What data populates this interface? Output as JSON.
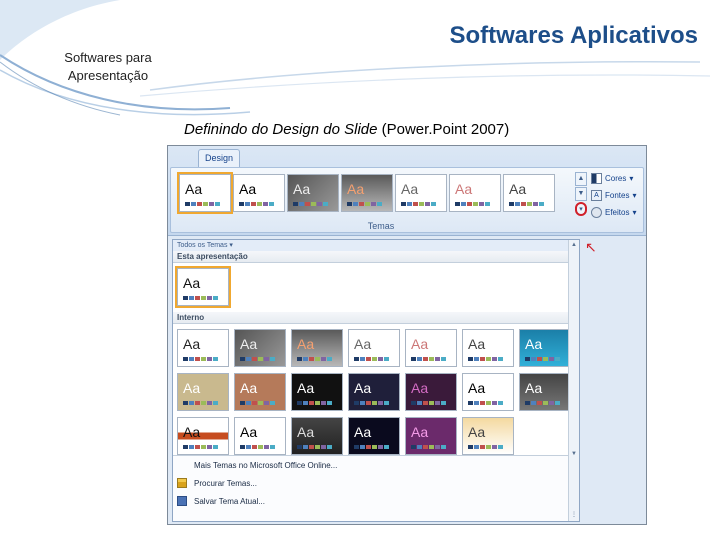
{
  "slide": {
    "title": "Softwares Aplicativos",
    "subtitle": "Softwares para Apresentação",
    "caption_italic": "Definindo do Design do Slide",
    "caption_rest": " (Power.Point 2007)"
  },
  "ribbon": {
    "tab_label": "Design",
    "group_label": "Temas",
    "cmds": [
      {
        "label": "Cores",
        "icon": "colors-icon"
      },
      {
        "label": "Fontes",
        "icon": "fonts-icon"
      },
      {
        "label": "Efeitos",
        "icon": "effects-icon"
      }
    ],
    "annotation_color": "#d0202a"
  },
  "gallery": {
    "header": "Todos os Temas",
    "section_current": "Esta apresentação",
    "section_builtin": "Interno",
    "menu": [
      {
        "label": "Mais Temas no Microsoft Office Online..."
      },
      {
        "label": "Procurar Temas..."
      },
      {
        "label": "Salvar Tema Atual..."
      }
    ]
  },
  "themes": {
    "thumb_text": "Aa",
    "ribbon_strip": [
      "t-office",
      "t-apex",
      "t-aspect",
      "t-civic",
      "t-concourse",
      "t-equity",
      "t-flow"
    ],
    "current": [
      "t-office"
    ],
    "builtin": [
      "t-blank",
      "t-aspect",
      "t-civic",
      "t-concourse",
      "t-equity",
      "t-flow",
      "t-metro",
      "t-module",
      "t-opulent",
      "t-oriel",
      "t-origin",
      "t-paper",
      "t-solstice",
      "t-technic",
      "t-red",
      "t-flowery",
      "t-verve",
      "t-black",
      "t-purple",
      "t-gold"
    ]
  }
}
